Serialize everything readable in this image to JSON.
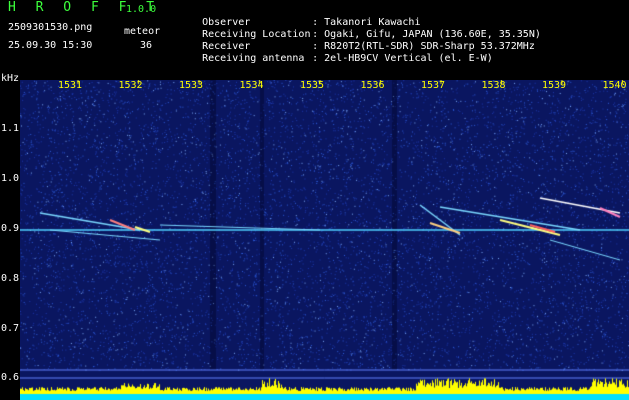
{
  "header": {
    "app_title": "H R O F F T",
    "app_version": "1.0.0",
    "filename": "2509301530.png",
    "datetime": "25.09.30 15:30",
    "meteor_label": "meteor",
    "meteor_count": "36"
  },
  "info": {
    "observer_label": "Observer",
    "observer_value": ": Takanori Kawachi",
    "location_label": "Receiving Location",
    "location_value": ": Ogaki, Gifu, JAPAN (136.60E, 35.35N)",
    "receiver_label": "Receiver",
    "receiver_value": ": R820T2(RTL-SDR) SDR-Sharp 53.372MHz",
    "antenna_label": "Receiving antenna",
    "antenna_value": ": 2el-HB9CV Vertical (el. E-W)"
  },
  "spectrogram": {
    "y_unit": "kHz",
    "y_ticks": [
      "1.1",
      "1.0",
      "0.9",
      "0.8",
      "0.7",
      "0.6"
    ],
    "x_ticks": [
      "1531",
      "1532",
      "1533",
      "1534",
      "1535",
      "1536",
      "1537",
      "1538",
      "1539",
      "1540"
    ],
    "colors": {
      "background": "#0a1660",
      "carrier": "#4fd0ff",
      "meteor": "#ffffff",
      "power_bar": "#ffff00",
      "baseline": "#00e0ff"
    }
  }
}
